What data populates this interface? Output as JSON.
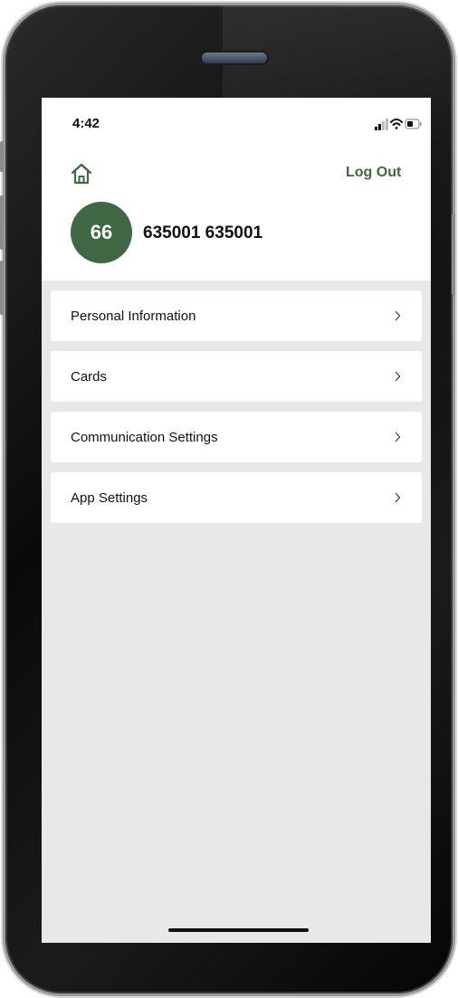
{
  "status_bar": {
    "time": "4:42"
  },
  "header": {
    "logout_label": "Log Out",
    "avatar_initials": "66",
    "user_name": "635001 635001"
  },
  "menu": {
    "items": [
      {
        "label": "Personal Information"
      },
      {
        "label": "Cards"
      },
      {
        "label": "Communication Settings"
      },
      {
        "label": "App Settings"
      }
    ]
  },
  "colors": {
    "accent": "#3e6a43",
    "avatar_bg": "#3f6744",
    "screen_bg": "#e8e8e8"
  },
  "icons": {
    "home": "home-icon",
    "chevron": "chevron-right-icon",
    "signal": "signal-icon",
    "wifi": "wifi-icon",
    "battery": "battery-icon"
  }
}
